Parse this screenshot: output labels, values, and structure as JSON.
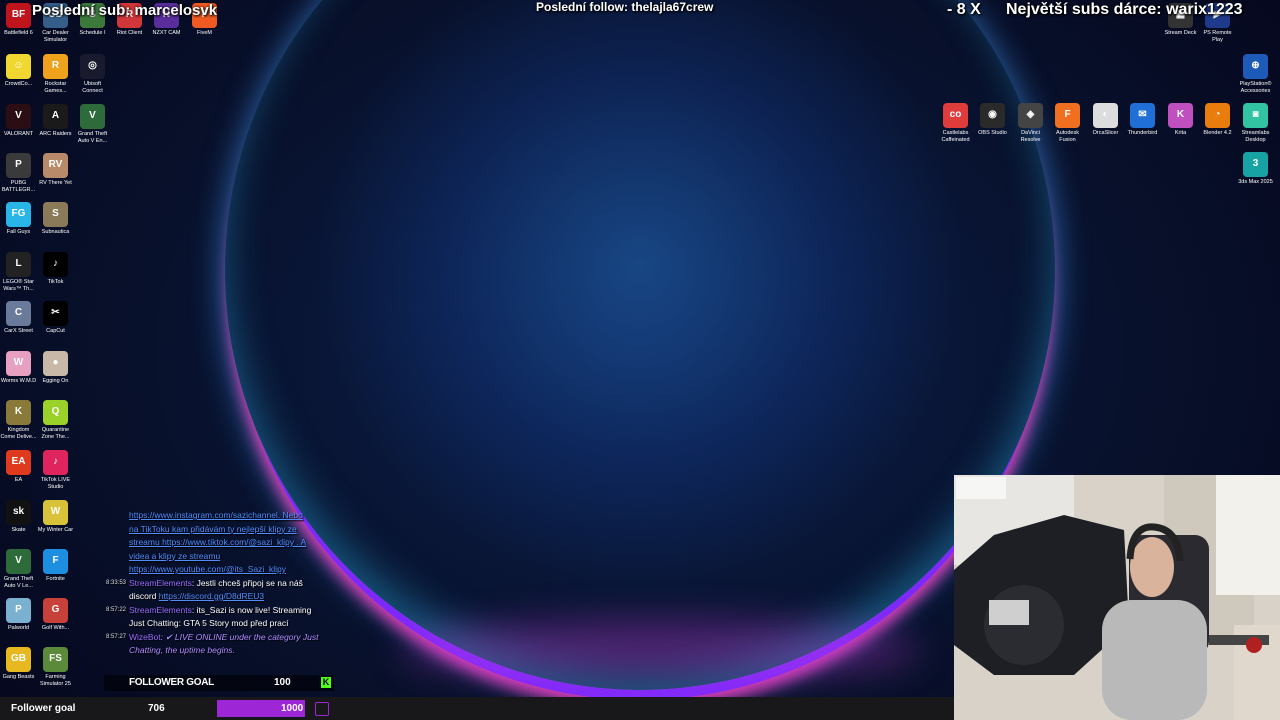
{
  "overlay": {
    "last_sub": "Poslední sub: marcelosvk",
    "last_follow": "Poslední follow: thelajla67crew",
    "multiplier": "- 8 X",
    "top_donor": "Největší subs dárce: warix1223"
  },
  "desktop_icons_left": [
    {
      "label": "Battlefield 6",
      "icon": "battlefield-icon",
      "color": "#c0141c",
      "glyph": "BF"
    },
    {
      "label": "Car Dealer Simulator",
      "icon": "car-dealer-icon",
      "color": "#355e8a",
      "glyph": "CD"
    },
    {
      "label": "Schedule I",
      "icon": "schedule-icon",
      "color": "#3c7a3c",
      "glyph": "S"
    },
    {
      "label": "Riot Client",
      "icon": "riot-icon",
      "color": "#d13639",
      "glyph": "R"
    },
    {
      "label": "NZXT CAM",
      "icon": "nzxt-icon",
      "color": "#5a2d9c",
      "glyph": "N"
    },
    {
      "label": "FiveM",
      "icon": "fivem-icon",
      "color": "#f05a22",
      "glyph": "F"
    },
    {
      "label": "CrowdCo...",
      "icon": "crowd-icon",
      "color": "#f1d830",
      "glyph": "☺"
    },
    {
      "label": "Rockstar Games...",
      "icon": "rockstar-icon",
      "color": "#f0a21c",
      "glyph": "R"
    },
    {
      "label": "Ubisoft Connect",
      "icon": "ubisoft-icon",
      "color": "#1a1a2e",
      "glyph": "◎"
    },
    {
      "label": "VALORANT",
      "icon": "valorant-icon",
      "color": "#2b0d14",
      "glyph": "V"
    },
    {
      "label": "ARC Raiders",
      "icon": "arc-raiders-icon",
      "color": "#1a1a1a",
      "glyph": "A"
    },
    {
      "label": "Grand Theft Auto V En...",
      "icon": "gta-icon",
      "color": "#2e6b3a",
      "glyph": "V"
    },
    {
      "label": "PUBG BATTLEGR...",
      "icon": "pubg-icon",
      "color": "#3a3a3a",
      "glyph": "P"
    },
    {
      "label": "RV There Yet",
      "icon": "rv-icon",
      "color": "#b88a6a",
      "glyph": "RV"
    },
    {
      "label": "Fall Guys",
      "icon": "fallguys-icon",
      "color": "#2ab5e8",
      "glyph": "FG"
    },
    {
      "label": "Subnautica",
      "icon": "subnautica-icon",
      "color": "#8a7a5a",
      "glyph": "S"
    },
    {
      "label": "LEGO® Star Wars™ Th...",
      "icon": "lego-icon",
      "color": "#222",
      "glyph": "L"
    },
    {
      "label": "TikTok",
      "icon": "tiktok-icon",
      "color": "#000",
      "glyph": "♪"
    },
    {
      "label": "CarX Street",
      "icon": "carx-icon",
      "color": "#6a7a9a",
      "glyph": "C"
    },
    {
      "label": "CapCut",
      "icon": "capcut-icon",
      "color": "#000",
      "glyph": "✂"
    },
    {
      "label": "Worms W.M.D",
      "icon": "worms-icon",
      "color": "#e8a0c0",
      "glyph": "W"
    },
    {
      "label": "Egging On",
      "icon": "egg-icon",
      "color": "#c8b8a8",
      "glyph": "●"
    },
    {
      "label": "Kingdom Come Delive...",
      "icon": "kingdom-icon",
      "color": "#8a7a3a",
      "glyph": "K"
    },
    {
      "label": "Quarantine Zone The...",
      "icon": "quarantine-icon",
      "color": "#9ad22a",
      "glyph": "Q"
    },
    {
      "label": "EA",
      "icon": "ea-icon",
      "color": "#e03a1e",
      "glyph": "EA"
    },
    {
      "label": "TikTok LIVE Studio",
      "icon": "tiktok-live-icon",
      "color": "#e0245e",
      "glyph": "♪"
    },
    {
      "label": "Skate",
      "icon": "skate-icon",
      "color": "#111",
      "glyph": "sk"
    },
    {
      "label": "My Winter Car",
      "icon": "winter-car-icon",
      "color": "#d8c23a",
      "glyph": "W"
    },
    {
      "label": "Grand Theft Auto V Le...",
      "icon": "gta-legacy-icon",
      "color": "#2e6b3a",
      "glyph": "V"
    },
    {
      "label": "Fortnite",
      "icon": "fortnite-icon",
      "color": "#1e8fe0",
      "glyph": "F"
    },
    {
      "label": "Palworld",
      "icon": "palworld-icon",
      "color": "#7ab0d0",
      "glyph": "P"
    },
    {
      "label": "Golf With...",
      "icon": "golf-icon",
      "color": "#c8403a",
      "glyph": "G"
    },
    {
      "label": "Gang Beasts",
      "icon": "gang-icon",
      "color": "#e8b820",
      "glyph": "GB"
    },
    {
      "label": "Farming Simulator 25",
      "icon": "farming-icon",
      "color": "#5a8a3a",
      "glyph": "FS"
    }
  ],
  "desktop_icons_right": [
    {
      "label": "Stream Deck",
      "icon": "stream-deck-icon",
      "color": "#333",
      "glyph": "▦"
    },
    {
      "label": "PS Remote Play",
      "icon": "ps-remote-icon",
      "color": "#1e3a8a",
      "glyph": "▶"
    },
    {
      "label": "PlayStation® Accessories",
      "icon": "ps-accessories-icon",
      "color": "#1e5ab8",
      "glyph": "⊕"
    },
    {
      "label": "Castlelabs Caffeinated",
      "icon": "caffeinated-icon",
      "color": "#e03c3c",
      "glyph": "co"
    },
    {
      "label": "OBS Studio",
      "icon": "obs-icon",
      "color": "#2a2a2a",
      "glyph": "◉"
    },
    {
      "label": "DaVinci Resolve",
      "icon": "davinci-icon",
      "color": "#444",
      "glyph": "◈"
    },
    {
      "label": "Autodesk Fusion",
      "icon": "fusion-icon",
      "color": "#f07020",
      "glyph": "F"
    },
    {
      "label": "OrcaSlicer",
      "icon": "orca-icon",
      "color": "#ddd",
      "glyph": "◐"
    },
    {
      "label": "Thunderbird",
      "icon": "thunderbird-icon",
      "color": "#1f6fd6",
      "glyph": "✉"
    },
    {
      "label": "Krita",
      "icon": "krita-icon",
      "color": "#c050c0",
      "glyph": "K"
    },
    {
      "label": "Blender 4.2",
      "icon": "blender-icon",
      "color": "#e87d0d",
      "glyph": "◔"
    },
    {
      "label": "Streamlabs Desktop",
      "icon": "streamlabs-icon",
      "color": "#31c3a2",
      "glyph": "◙"
    },
    {
      "label": "3ds Max 2025",
      "icon": "3dsmax-icon",
      "color": "#17a3a3",
      "glyph": "3"
    }
  ],
  "chat": {
    "lines": [
      {
        "time": "",
        "user": "",
        "text": "",
        "link": "https://www.instagram.com/sazichannel. Nebo"
      },
      {
        "time": "",
        "user": "",
        "text": "na TikToku kam přidávám ty nejlepší klipy ze streamu ",
        "link": "https://www.tiktok.com/@sazi_klipy . A videa a klipy ze streamu"
      },
      {
        "time": "",
        "user": "",
        "text": "",
        "link": "https://www.youtube.com/@its_Sazi_klipy"
      },
      {
        "time": "8:33:53",
        "user": "StreamElements",
        "text": ": Jestli chceš připoj se na náš discord ",
        "link": "https://discord.gg/D8dREU3"
      },
      {
        "time": "8:57:22",
        "user": "StreamElements",
        "text": ": its_Sazi is now live! Streaming Just Chatting: GTA 5 Story mod před prací",
        "link": ""
      },
      {
        "time": "8:57:27",
        "user": "WizeBot",
        "text": ": ✔ LIVE ONLINE under the category Just Chatting, the uptime begins.",
        "link": ""
      }
    ]
  },
  "follower_widget": {
    "label": "FOLLOWER GOAL",
    "target": "100"
  },
  "goal_bar": {
    "label": "Follower goal",
    "current": "706",
    "target": "1000",
    "progress_fraction": 0.706
  },
  "colors": {
    "accent_purple": "#9d27d6",
    "link_blue": "#4f8dff",
    "username_purple": "#9b6bff"
  }
}
